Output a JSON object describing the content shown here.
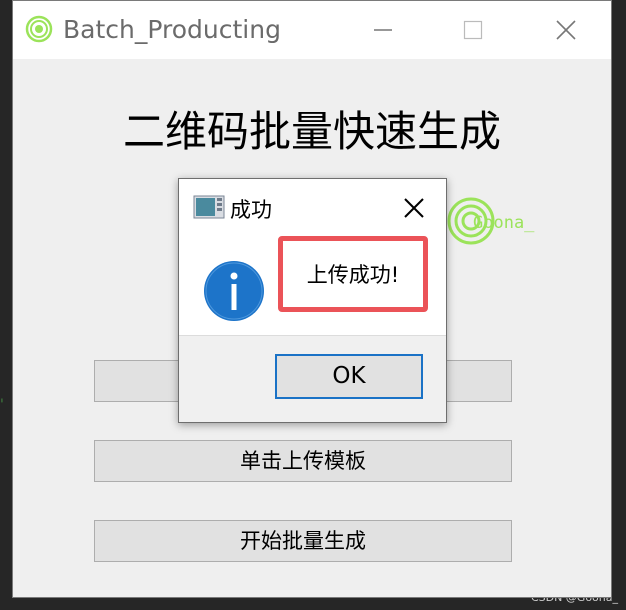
{
  "window": {
    "title": "Batch_Producting",
    "heading": "二维码批量快速生成"
  },
  "logo": {
    "text": "Goona_"
  },
  "buttons": {
    "btn1_label": "",
    "upload_template": "单击上传模板",
    "start_batch": "开始批量生成"
  },
  "dialog": {
    "title": "成功",
    "message": "上传成功!",
    "ok_label": "OK"
  },
  "watermark": "CSDN @Goona_",
  "background_code": "'"
}
